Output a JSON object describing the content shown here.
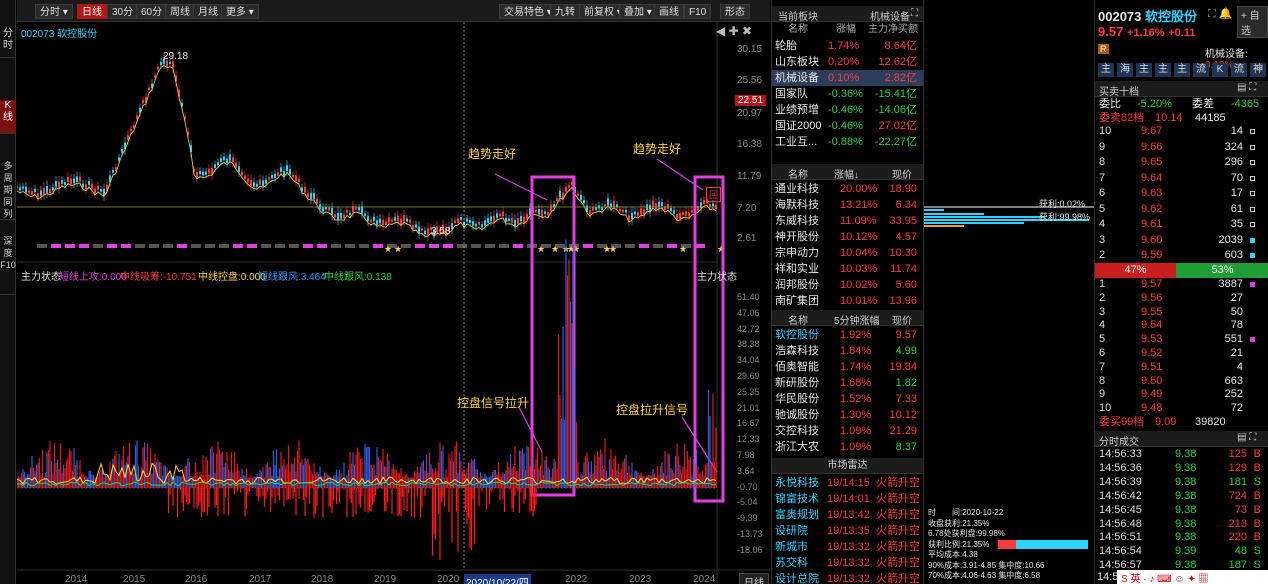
{
  "left_tabs": [
    "分时",
    "K线",
    "多周期同列",
    "深度F10"
  ],
  "toolbar": {
    "buttons": [
      "分时 ▾",
      "日线",
      "30分",
      "60分",
      "周线",
      "月线",
      "更多 ▾"
    ],
    "right_buttons": [
      "交易特色 ▾",
      "九转",
      "前复权 ▾",
      "叠加 ▾",
      "画线",
      "F10",
      "形态"
    ]
  },
  "chart": {
    "code_name": "002073 软控股份",
    "price_ticks": [
      "30.15",
      "25.56",
      "20.97",
      "16.38",
      "11.79",
      "7.20",
      "2.61"
    ],
    "current_price_tag": "22.51",
    "peak_label": "29.18",
    "low_label": "3.58",
    "annotations": [
      "趋势走好",
      "趋势走好",
      "控盘信号拉升",
      "控盘拉升信号"
    ],
    "indicator_title": "主力状态",
    "indicator_legend": [
      {
        "text": "短线上攻:0.000",
        "color": "#e23ee2"
      },
      {
        "text": "中线吸筹:-10.751",
        "color": "#ff3b3b"
      },
      {
        "text": "中线控盘:0.000",
        "color": "#ffd23f"
      },
      {
        "text": "短线跟风:3.464",
        "color": "#2f9bff"
      },
      {
        "text": "中线跟风:0.138",
        "color": "#26d63c"
      }
    ],
    "indicator_right_label": "主力状态",
    "indicator_ticks": [
      "51.40",
      "47.06",
      "42.72",
      "38.38",
      "34.04",
      "29.69",
      "25.35",
      "21.01",
      "16.67",
      "12.33",
      "7.98",
      "3.64",
      "-0.70",
      "-5.04",
      "-9.39",
      "-13.73",
      "-18.06"
    ],
    "years": [
      "2014",
      "2015",
      "2016",
      "2017",
      "2018",
      "2019",
      "2020",
      "2020/10/22/四",
      "2022",
      "2023",
      "2024"
    ],
    "period_btn": "日线",
    "badge_label": "回"
  },
  "sectors": {
    "header": "当前板块",
    "header2": "机械设备",
    "cols": [
      "名称",
      "涨幅",
      "主力净买额"
    ],
    "rows": [
      [
        "轮胎",
        "1.74%",
        "8.64亿"
      ],
      [
        "山东板块",
        "0.20%",
        "12.62亿"
      ],
      [
        "机械设备",
        "0.10%",
        "2.82亿"
      ],
      [
        "国家队",
        "-0.36%",
        "-15.41亿"
      ],
      [
        "业绩预增",
        "-0.46%",
        "-14.06亿"
      ],
      [
        "国证2000",
        "-0.46%",
        "27.02亿"
      ],
      [
        "工业互...",
        "-0.88%",
        "-22.27亿"
      ]
    ]
  },
  "gainers": {
    "cols": [
      "名称",
      "涨幅↓",
      "现价"
    ],
    "rows": [
      [
        "通业科技",
        "20.00%",
        "18.90"
      ],
      [
        "海默科技",
        "13.21%",
        "6.34"
      ],
      [
        "东威科技",
        "11.09%",
        "33.95"
      ],
      [
        "神开股份",
        "10.12%",
        "4.57"
      ],
      [
        "宗申动力",
        "10.04%",
        "10.30"
      ],
      [
        "祥和实业",
        "10.03%",
        "11.74"
      ],
      [
        "润邦股份",
        "10.02%",
        "5.60"
      ],
      [
        "南矿集团",
        "10.01%",
        "13.96"
      ]
    ]
  },
  "fivemin": {
    "cols": [
      "名称",
      "5分钟涨幅",
      "现价"
    ],
    "rows": [
      [
        "软控股份",
        "1.92%",
        "9.57"
      ],
      [
        "浩森科技",
        "1.84%",
        "4.99"
      ],
      [
        "佰奥智能",
        "1.74%",
        "19.84"
      ],
      [
        "新研股份",
        "1.68%",
        "1.82"
      ],
      [
        "华民股份",
        "1.52%",
        "7.33"
      ],
      [
        "驰诚股份",
        "1.30%",
        "10.12"
      ],
      [
        "交控科技",
        "1.09%",
        "21.29"
      ],
      [
        "浙江大农",
        "1.09%",
        "8.37"
      ]
    ]
  },
  "radar": {
    "title": "市场雷达",
    "rows": [
      [
        "永悦科技",
        "19/14:15",
        "火箭升空"
      ],
      [
        "锦富技术",
        "19/14:01",
        "火箭升空"
      ],
      [
        "富奥规划",
        "19/13:42",
        "火箭升空"
      ],
      [
        "设研院",
        "19/13:35",
        "火箭升空"
      ],
      [
        "新城市",
        "19/13:32",
        "火箭升空"
      ],
      [
        "苏交科",
        "19/13:32",
        "火箭升空"
      ],
      [
        "设计总院",
        "19/13:32",
        "火箭升空"
      ]
    ]
  },
  "chip": {
    "profit_ratio_top": "获利:0.02%",
    "profit_ratio": "获利:99.98%",
    "info": [
      "时　　间:2020-10-22",
      "收盘获利:21.35%",
      "6.78处获利盘:99.98%",
      "获利比例:21.35%",
      "平均成本:4.38",
      "90%成本:3.91-4.85 集中度:10.66",
      "70%成本:4.06-4.63 集中度:6.58"
    ]
  },
  "stock": {
    "code": "002073",
    "name": "软控股份",
    "price": "9.57",
    "chg_pct": "+1.16%",
    "chg": "+0.11",
    "industry_badge": "R",
    "industry": "机械设备",
    "industry_chg": "0.10%",
    "tabs": [
      "主",
      "海",
      "主",
      "主",
      "主",
      "流",
      "K",
      "流",
      "神"
    ],
    "section": "买卖十档",
    "wb_label": "委比",
    "wb": "-5.20%",
    "wc_label": "委差",
    "wc": "-4365",
    "sell_total_label": "委卖82档",
    "sell_total_px": "10.14",
    "sell_total_vol": "44185",
    "asks": [
      [
        "10",
        "9.67",
        "14"
      ],
      [
        "9",
        "9.66",
        "324"
      ],
      [
        "8",
        "9.65",
        "296"
      ],
      [
        "7",
        "9.64",
        "70"
      ],
      [
        "6",
        "9.63",
        "17"
      ],
      [
        "5",
        "9.62",
        "61"
      ],
      [
        "4",
        "9.61",
        "35"
      ],
      [
        "3",
        "9.60",
        "2039"
      ],
      [
        "2",
        "9.59",
        "603"
      ],
      [
        "1",
        "9.58",
        "692"
      ]
    ],
    "ratio_sell": "47%",
    "ratio_buy": "53%",
    "bids": [
      [
        "1",
        "9.57",
        "3887"
      ],
      [
        "2",
        "9.56",
        "27"
      ],
      [
        "3",
        "9.55",
        "50"
      ],
      [
        "4",
        "9.54",
        "78"
      ],
      [
        "5",
        "9.53",
        "551"
      ],
      [
        "6",
        "9.52",
        "21"
      ],
      [
        "7",
        "9.51",
        "4"
      ],
      [
        "8",
        "9.50",
        "663"
      ],
      [
        "9",
        "9.49",
        "252"
      ],
      [
        "10",
        "9.48",
        "72"
      ]
    ],
    "buy_total_label": "委买99档",
    "buy_total_px": "9.09",
    "buy_total_vol": "39820",
    "ticks_title": "分时成交",
    "ticks": [
      [
        "14:56:33",
        "9.38",
        "125",
        "B"
      ],
      [
        "14:56:36",
        "9.38",
        "129",
        "B"
      ],
      [
        "14:56:39",
        "9.38",
        "181",
        "S"
      ],
      [
        "14:56:42",
        "9.38",
        "724",
        "B"
      ],
      [
        "14:56:45",
        "9.38",
        "73",
        "B"
      ],
      [
        "14:56:48",
        "9.38",
        "213",
        "B"
      ],
      [
        "14:56:51",
        "9.38",
        "220",
        "B"
      ],
      [
        "14:56:54",
        "9.39",
        "48",
        "S"
      ],
      [
        "14:56:57",
        "9.38",
        "187",
        "S"
      ]
    ],
    "self_select": "+ 自选",
    "industry_label": "机械设备",
    "last_tick_time": "14:57"
  },
  "colors": {
    "up": "#ff3b3b",
    "down": "#26d63c",
    "accent": "#e23ee2"
  }
}
